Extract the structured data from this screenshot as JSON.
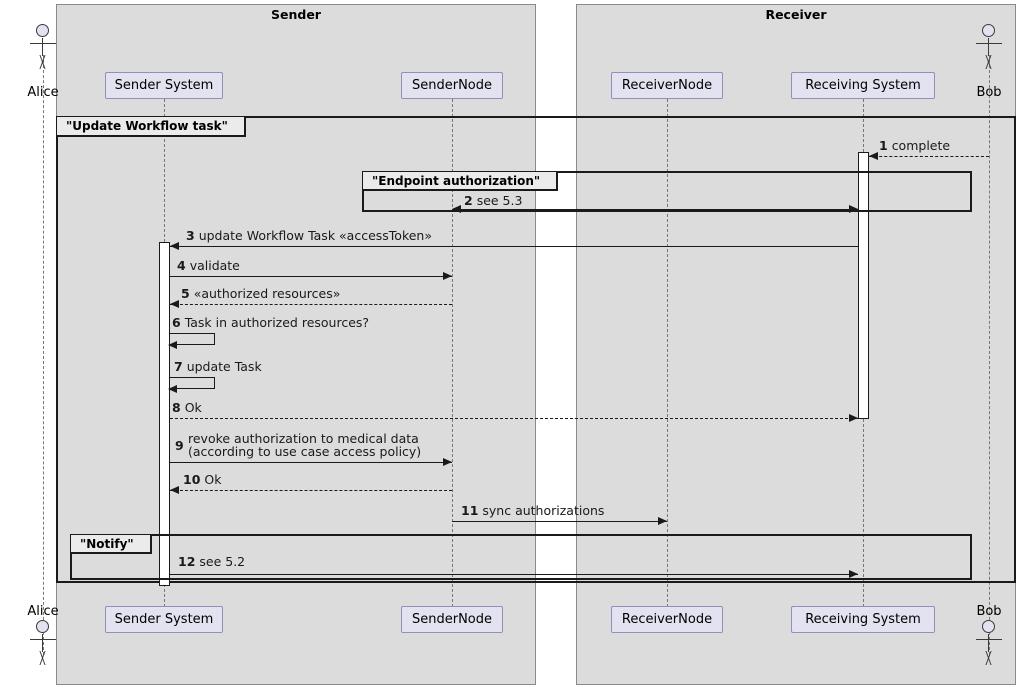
{
  "diagram": {
    "type": "uml-sequence-diagram",
    "groups": [
      {
        "id": "sender",
        "title": "Sender"
      },
      {
        "id": "receiver",
        "title": "Receiver"
      }
    ],
    "actors": [
      {
        "id": "alice",
        "label": "Alice"
      },
      {
        "id": "bob",
        "label": "Bob"
      }
    ],
    "participants": [
      {
        "id": "sender-system",
        "label": "Sender System"
      },
      {
        "id": "sender-node",
        "label": "SenderNode"
      },
      {
        "id": "receiver-node",
        "label": "ReceiverNode"
      },
      {
        "id": "receiving-system",
        "label": "Receiving System"
      }
    ],
    "fragments": [
      {
        "id": "update-workflow-task",
        "label": "\"Update Workflow task\""
      },
      {
        "id": "endpoint-authorization",
        "label": "\"Endpoint authorization\""
      },
      {
        "id": "notify",
        "label": "\"Notify\""
      }
    ],
    "messages": [
      {
        "num": "1",
        "text": "complete",
        "from": "bob",
        "to": "receiving-system",
        "style": "dotted",
        "dir": "left"
      },
      {
        "num": "2",
        "text": "see 5.3",
        "from": "receiving-system",
        "to": "sender-node",
        "style": "solid",
        "dir": "left"
      },
      {
        "num": "3",
        "text": "update Workflow Task «accessToken»",
        "from": "receiving-system",
        "to": "sender-system",
        "style": "solid",
        "dir": "left"
      },
      {
        "num": "4",
        "text": "validate",
        "from": "sender-system",
        "to": "sender-node",
        "style": "solid",
        "dir": "right"
      },
      {
        "num": "5",
        "text": "«authorized resources»",
        "from": "sender-node",
        "to": "sender-system",
        "style": "dotted",
        "dir": "left"
      },
      {
        "num": "6",
        "text": "Task in authorized resources?",
        "from": "sender-system",
        "to": "sender-system",
        "style": "self",
        "dir": "left"
      },
      {
        "num": "7",
        "text": "update Task",
        "from": "sender-system",
        "to": "sender-system",
        "style": "self",
        "dir": "left"
      },
      {
        "num": "8",
        "text": "Ok",
        "from": "sender-system",
        "to": "receiving-system",
        "style": "dotted",
        "dir": "right"
      },
      {
        "num": "9",
        "text": "revoke authorization to medical data",
        "text2": "(according to use case access policy)",
        "from": "sender-system",
        "to": "sender-node",
        "style": "solid",
        "dir": "right"
      },
      {
        "num": "10",
        "text": "Ok",
        "from": "sender-node",
        "to": "sender-system",
        "style": "dotted",
        "dir": "left"
      },
      {
        "num": "11",
        "text": "sync authorizations",
        "from": "sender-node",
        "to": "receiver-node",
        "style": "solid",
        "dir": "right"
      },
      {
        "num": "12",
        "text": "see 5.2",
        "from": "sender-system",
        "to": "receiving-system",
        "style": "solid",
        "dir": "right"
      }
    ],
    "colors": {
      "group_fill": "#dcdcdc",
      "participant_fill": "#e2e2f0",
      "participant_border": "#9090b8",
      "line": "#1a1a1a",
      "lifeline": "#777777",
      "fragment_label_fill": "#ebebeb"
    }
  }
}
